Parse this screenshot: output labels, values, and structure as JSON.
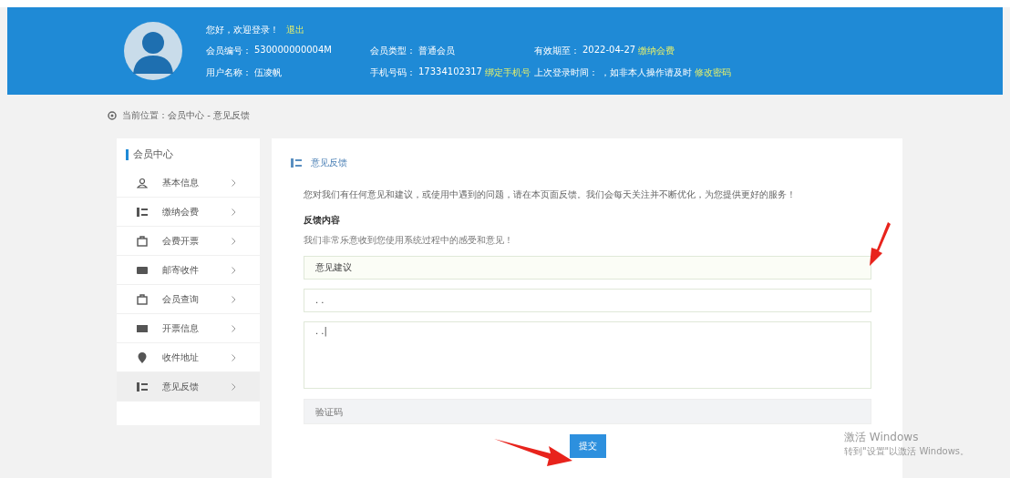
{
  "header": {
    "greeting": "您好，欢迎登录！",
    "logout": "退出",
    "fields": [
      {
        "label": "会员编号：",
        "value": "530000000004M"
      },
      {
        "label": "会员类型：",
        "value": "普通会员"
      },
      {
        "label": "有效期至：",
        "value": "2022-04-27",
        "link": "缴纳会费"
      },
      {
        "label": "用户名称：",
        "value": "伍凌帆"
      },
      {
        "label": "手机号码：",
        "value": "17334102317",
        "link": "绑定手机号"
      },
      {
        "label": "上次登录时间：",
        "value": "，如非本人操作请及时",
        "link": "修改密码"
      }
    ]
  },
  "breadcrumb": "当前位置：会员中心 - 意见反馈",
  "sidebar": {
    "title": "会员中心",
    "items": [
      {
        "label": "基本信息",
        "kind": "user",
        "selected": false
      },
      {
        "label": "缴纳会费",
        "kind": "list",
        "selected": false
      },
      {
        "label": "会费开票",
        "kind": "doc",
        "selected": false
      },
      {
        "label": "邮寄收件",
        "kind": "mail",
        "selected": false
      },
      {
        "label": "会员查询",
        "kind": "doc",
        "selected": false
      },
      {
        "label": "开票信息",
        "kind": "card",
        "selected": false
      },
      {
        "label": "收件地址",
        "kind": "pin",
        "selected": false
      },
      {
        "label": "意见反馈",
        "kind": "list",
        "selected": true
      }
    ]
  },
  "panel": {
    "title": "意见反馈",
    "intro": "您对我们有任何意见和建议，或使用中遇到的问题，请在本页面反馈。我们会每天关注并不断优化，为您提供更好的服务！",
    "section": "反馈内容",
    "hint": "我们非常乐意收到您使用系统过程中的感受和意见！",
    "type_select": "意见建议",
    "input_value": ". .",
    "textarea_value": ". .|",
    "code_placeholder": "验证码",
    "submit": "提交"
  },
  "watermark": {
    "title": "激活 Windows",
    "subtitle": "转到\"设置\"以激活 Windows。"
  }
}
